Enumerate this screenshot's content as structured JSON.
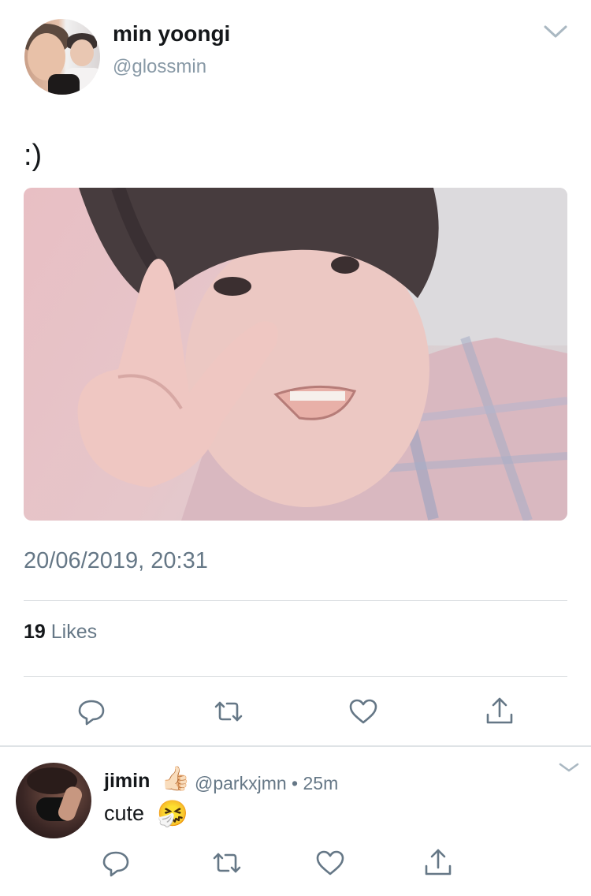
{
  "tweet": {
    "author_name": "min yoongi",
    "author_handle": "@glossmin",
    "text": ":)",
    "timestamp": "20/06/2019, 20:31",
    "likes_count": "19",
    "likes_label": "Likes",
    "icons": [
      "chevron-down-icon",
      "reply-icon",
      "retweet-icon",
      "like-icon",
      "share-icon"
    ]
  },
  "reply": {
    "author_name": "jimin",
    "name_emoji": "👍🏻",
    "handle": "@parkxjmn",
    "separator": "•",
    "time": "25m",
    "text": "cute",
    "text_emoji": "🤧"
  },
  "colors": {
    "text_primary": "#14171a",
    "text_secondary": "#657786",
    "divider": "#d9dde0"
  }
}
